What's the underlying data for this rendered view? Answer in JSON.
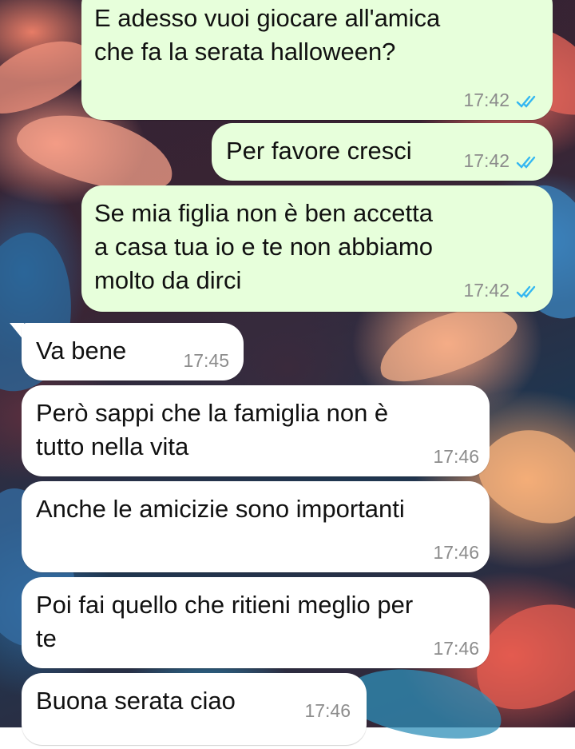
{
  "messages": [
    {
      "direction": "outgoing",
      "text": "E adesso vuoi giocare all'amica\nche fa la serata halloween?",
      "time": "17:42",
      "status_icon": "double-check-read-icon"
    },
    {
      "direction": "outgoing",
      "text": "Per favore cresci",
      "time": "17:42",
      "status_icon": "double-check-read-icon"
    },
    {
      "direction": "outgoing",
      "text": "Se mia figlia non è ben accetta\na casa tua io e te non abbiamo\nmolto da dirci",
      "time": "17:42",
      "status_icon": "double-check-read-icon"
    },
    {
      "direction": "incoming",
      "text": "Va bene",
      "time": "17:45"
    },
    {
      "direction": "incoming",
      "text": "Però sappi che la famiglia non è\ntutto nella vita",
      "time": "17:46"
    },
    {
      "direction": "incoming",
      "text": "Anche le amicizie sono importanti",
      "time": "17:46"
    },
    {
      "direction": "incoming",
      "text": "Poi fai quello che ritieni meglio per\nte",
      "time": "17:46"
    },
    {
      "direction": "incoming",
      "text": "Buona serata ciao",
      "time": "17:46"
    }
  ],
  "colors": {
    "outgoing_bubble": "#e7ffdb",
    "incoming_bubble": "#ffffff",
    "read_ticks": "#34b7f1",
    "timestamp": "#8c8c8c"
  }
}
